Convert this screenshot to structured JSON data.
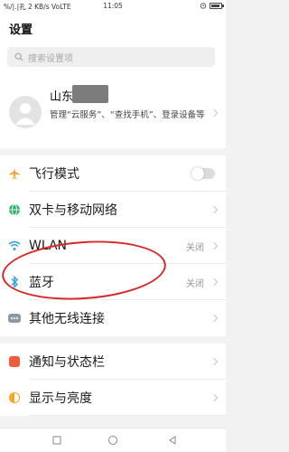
{
  "status_bar": {
    "left": "%/|.|孔 2 KB/s VoLTE",
    "time": "11:05"
  },
  "header": {
    "title": "设置",
    "search_placeholder": "搜索设置项"
  },
  "profile": {
    "name": "山东",
    "description": "管理“云服务”、“查找手机”、登录设备等"
  },
  "settings": [
    {
      "label": "飞行模式",
      "icon": "airplane-icon",
      "value": "",
      "toggle_on": false
    },
    {
      "label": "双卡与移动网络",
      "icon": "globe-icon",
      "value": ""
    },
    {
      "label": "WLAN",
      "icon": "wifi-icon",
      "value": "关闭"
    },
    {
      "label": "蓝牙",
      "icon": "bluetooth-icon",
      "value": "关闭"
    },
    {
      "label": "其他无线连接",
      "icon": "more-connections-icon",
      "value": ""
    },
    {
      "label": "通知与状态栏",
      "icon": "notification-icon",
      "value": ""
    },
    {
      "label": "显示与亮度",
      "icon": "display-brightness-icon",
      "value": ""
    }
  ],
  "colors": {
    "annotation": "#d62828",
    "airplane": "#f4a623",
    "globe": "#2fb36e",
    "wifi": "#2b9de6",
    "bluetooth": "#2b9de6",
    "more": "#8c9aa8",
    "notification": "#ef5b3c",
    "display": "#f5a623"
  }
}
